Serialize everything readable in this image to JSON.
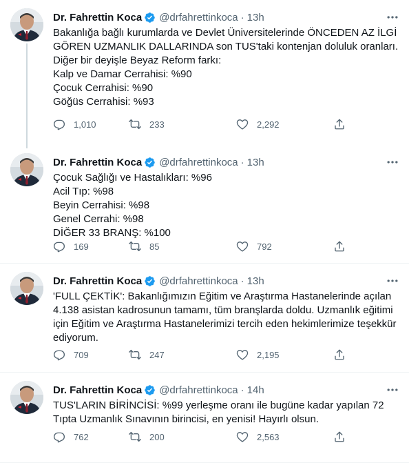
{
  "colors": {
    "text": "#0f1419",
    "muted": "#536471",
    "verified": "#1d9bf0",
    "divider": "#eff3f4",
    "thread_line": "#cfd9de"
  },
  "icons": {
    "verified": "verified-badge-icon",
    "more": "more-horizontal-icon",
    "reply": "reply-icon",
    "retweet": "retweet-icon",
    "like": "like-icon",
    "share": "share-icon"
  },
  "tweets": [
    {
      "author": "Dr. Fahrettin Koca",
      "handle": "@drfahrettinkoca",
      "dot": "·",
      "time": "13h",
      "lines": [
        "Bakanlığa bağlı kurumlarda ve Devlet Üniversitelerinde ÖNCEDEN AZ İLGİ",
        "GÖREN UZMANLIK DALLARINDA son TUS'taki kontenjan doluluk oranları.",
        "Diğer bir deyişle Beyaz Reform farkı:",
        "Kalp ve Damar Cerrahisi: %90",
        "Çocuk Cerrahisi: %90",
        "Göğüs Cerrahisi: %93"
      ],
      "replies": "1,010",
      "retweets": "233",
      "likes": "2,292"
    },
    {
      "author": "Dr. Fahrettin Koca",
      "handle": "@drfahrettinkoca",
      "dot": "·",
      "time": "13h",
      "lines": [
        "Çocuk Sağlığı ve Hastalıkları: %96",
        "Acil Tıp: %98",
        "Beyin Cerrahisi: %98",
        "Genel Cerrahi: %98",
        "DİĞER 33 BRANŞ: %100"
      ],
      "replies": "169",
      "retweets": "85",
      "likes": "792"
    },
    {
      "author": "Dr. Fahrettin Koca",
      "handle": "@drfahrettinkoca",
      "dot": "·",
      "time": "13h",
      "lines": [
        "'FULL ÇEKTİK': Bakanlığımızın Eğitim ve Araştırma Hastanelerinde açılan",
        "4.138 asistan kadrosunun tamamı, tüm branşlarda doldu. Uzmanlık eğitimi",
        "için Eğitim ve Araştırma Hastanelerimizi tercih eden hekimlerimize teşekkür",
        "ediyorum."
      ],
      "replies": "709",
      "retweets": "247",
      "likes": "2,195"
    },
    {
      "author": "Dr. Fahrettin Koca",
      "handle": "@drfahrettinkoca",
      "dot": "·",
      "time": "14h",
      "lines": [
        "TUS'LARIN BİRİNCİSİ: %99 yerleşme oranı ile bugüne kadar yapılan 72",
        "Tıpta Uzmanlık Sınavının birincisi, en yenisi! Hayırlı olsun."
      ],
      "replies": "762",
      "retweets": "200",
      "likes": "2,563"
    }
  ]
}
